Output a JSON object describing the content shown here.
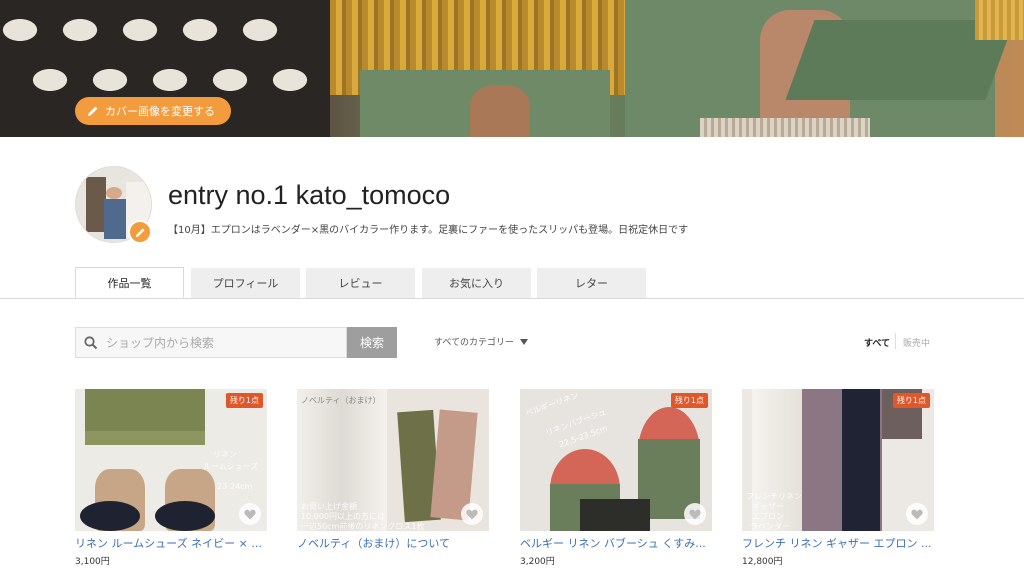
{
  "cover": {
    "change_button_label": "カバー画像を変更する"
  },
  "profile": {
    "shop_name": "entry no.1 kato_tomoco",
    "description": "【10月】エプロンはラベンダー×黒のバイカラー作ります。足裏にファーを使ったスリッパも登場。日祝定休日です"
  },
  "tabs": [
    {
      "label": "作品一覧",
      "active": true
    },
    {
      "label": "プロフィール",
      "active": false
    },
    {
      "label": "レビュー",
      "active": false
    },
    {
      "label": "お気に入り",
      "active": false
    },
    {
      "label": "レター",
      "active": false
    }
  ],
  "search": {
    "placeholder": "ショップ内から検索",
    "button_label": "検索",
    "category_label": "すべてのカテゴリー"
  },
  "filters": {
    "all": "すべて",
    "on_sale": "販売中"
  },
  "colors": {
    "accent": "#f39c3d",
    "badge": "#e0582a",
    "link": "#3a6fb7"
  },
  "products": [
    {
      "title": "リネン ルームシューズ ネイビー × ...",
      "price": "3,100円",
      "badge": "残り1点",
      "overlay": [
        "リネン",
        "ルームシューズ",
        "23-24cm"
      ]
    },
    {
      "title": "ノベルティ（おまけ）について",
      "price": "",
      "badge": "",
      "overlay": [
        "ノベルティ（おまけ）",
        "お買い上げ金額",
        "10,000円以上の方には",
        "一辺50cm前後のリネンクロス1枚"
      ]
    },
    {
      "title": "ベルギー リネン バブーシュ くすみ...",
      "price": "3,200円",
      "badge": "残り1点",
      "overlay": [
        "ベルギーリネン",
        "リネンバブーシュ",
        "22.5-23.5cm"
      ]
    },
    {
      "title": "フレンチ リネン ギャザー エプロン ...",
      "price": "12,800円",
      "badge": "残り1点",
      "overlay": [
        "フレンチリネン",
        "ギャザー",
        "エプロン",
        "ラベンダー"
      ]
    }
  ]
}
